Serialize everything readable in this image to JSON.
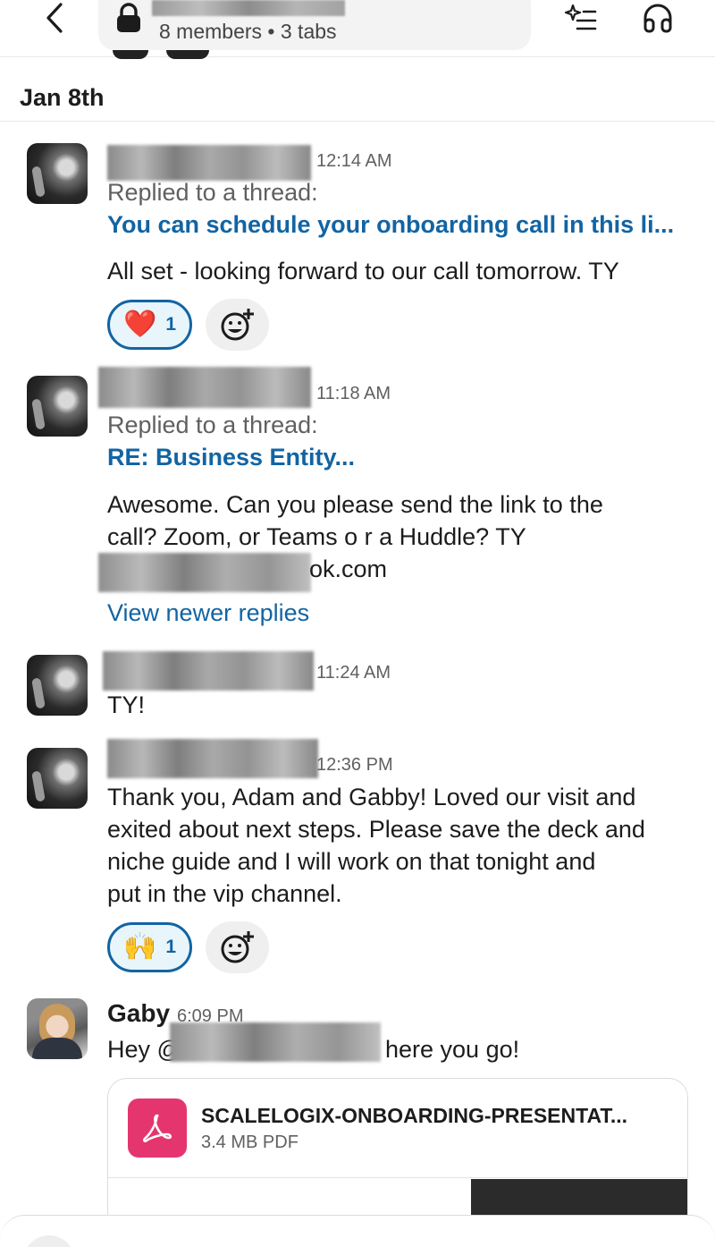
{
  "header": {
    "channel_sub": "8 members • 3 tabs",
    "icons": [
      "back-chevron-icon",
      "lock-icon",
      "ai-sparkle-list-icon",
      "headphones-icon"
    ]
  },
  "date_divider": "Jan 8th",
  "messages": [
    {
      "time": "12:14 AM",
      "replied_label": "Replied to a thread:",
      "thread_title": "You can schedule your onboarding call in this li...",
      "text": "All set - looking forward to our call tomorrow.  TY",
      "reaction": {
        "emoji": "❤️",
        "count": "1"
      }
    },
    {
      "time": "11:18 AM",
      "replied_label": "Replied to a thread:",
      "thread_title": "RE: Business Entity...",
      "text_line1": "Awesome. Can you please send the link to the",
      "text_line2": "call?  Zoom, or Teams o r a Huddle?  TY",
      "text_line3_tail": "ok.com",
      "view_newer": "View newer replies"
    },
    {
      "time": "11:24 AM",
      "text": "TY!"
    },
    {
      "time": "12:36 PM",
      "text_lines": [
        "Thank you, Adam and Gabby! Loved our visit and",
        "exited about next steps. Please save the deck and",
        "niche guide and I will work on that tonight and",
        "put in the vip channel."
      ],
      "reaction": {
        "emoji": "🙌",
        "count": "1"
      }
    },
    {
      "author": "Gaby",
      "time": "6:09 PM",
      "text_start": "Hey @",
      "text_end": "here you go!",
      "file": {
        "name": "SCALELOGIX-ONBOARDING-PRESENTAT...",
        "meta": "3.4 MB PDF"
      }
    }
  ]
}
